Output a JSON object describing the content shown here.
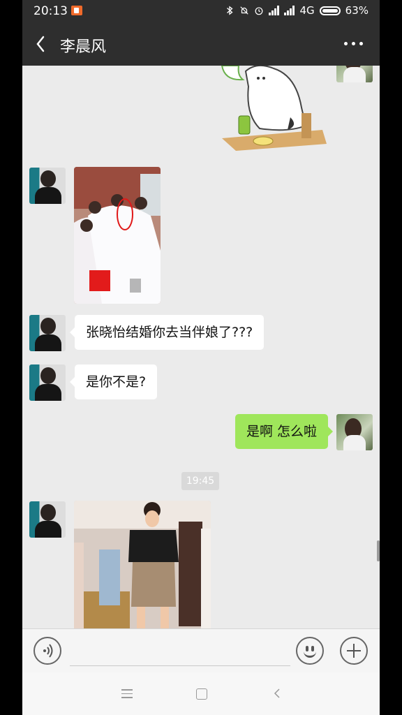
{
  "status_bar": {
    "time": "20:13",
    "network": "4G",
    "battery": "63%",
    "battery_level": 0.63,
    "icons": [
      "screen-record-icon",
      "bluetooth-icon",
      "mute-icon",
      "alarm-icon",
      "signal-icon",
      "signal-icon",
      "battery-icon"
    ]
  },
  "header": {
    "title": "李晨风",
    "back_icon": "chevron-left-icon",
    "more_icon": "more-dots-icon"
  },
  "messages": [
    {
      "type": "sticker",
      "side": "right",
      "description_icon": "cartoon-sticker"
    },
    {
      "type": "image",
      "side": "left"
    },
    {
      "type": "text",
      "side": "left",
      "text": "张晓怡结婚你去当伴娘了???"
    },
    {
      "type": "text",
      "side": "left",
      "text": "是你不是?"
    },
    {
      "type": "text",
      "side": "right",
      "text": "是啊   怎么啦"
    },
    {
      "type": "time",
      "text": "19:45"
    },
    {
      "type": "image",
      "side": "left"
    }
  ],
  "input_bar": {
    "voice_icon": "voice-icon",
    "placeholder": "",
    "emoji_icon": "emoji-icon",
    "plus_icon": "plus-icon"
  },
  "nav_bar": {
    "icons": [
      "menu-icon",
      "home-icon",
      "back-icon"
    ]
  },
  "colors": {
    "header_bg": "#2e2e2e",
    "chat_bg": "#ebebeb",
    "sent_bubble": "#9fe65b",
    "received_bubble": "#ffffff",
    "record_icon": "#f06a2a"
  }
}
